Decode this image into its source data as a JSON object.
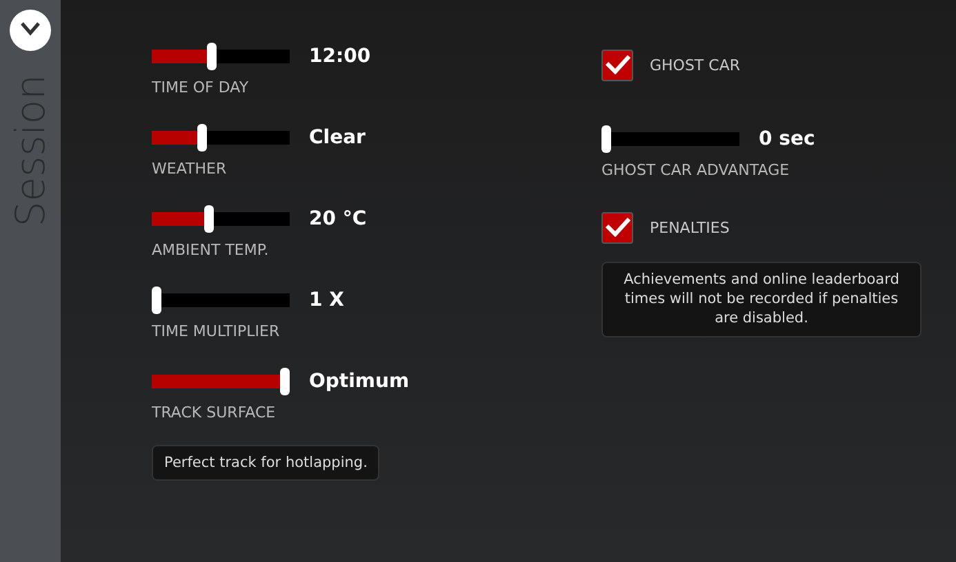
{
  "sidebar": {
    "title": "Session"
  },
  "sliders": [
    {
      "label": "TIME OF DAY",
      "value": "12:00",
      "level": 0.43
    },
    {
      "label": "WEATHER",
      "value": "Clear",
      "level": 0.36
    },
    {
      "label": "AMBIENT TEMP.",
      "value": "20 °C",
      "level": 0.41
    },
    {
      "label": "TIME MULTIPLIER",
      "value": "1 X",
      "level": 0
    },
    {
      "label": "TRACK SURFACE",
      "value": "Optimum",
      "level": 1
    }
  ],
  "track_note": "Perfect track for hotlapping.",
  "ghost_car": {
    "label": "GHOST CAR",
    "checked": true
  },
  "ghost_advantage": {
    "label": "GHOST CAR ADVANTAGE",
    "value": "0 sec",
    "level": 0
  },
  "penalties": {
    "label": "PENALTIES",
    "checked": true
  },
  "penalties_note": "Achievements and online leaderboard times will not be recorded if penalties are disabled."
}
